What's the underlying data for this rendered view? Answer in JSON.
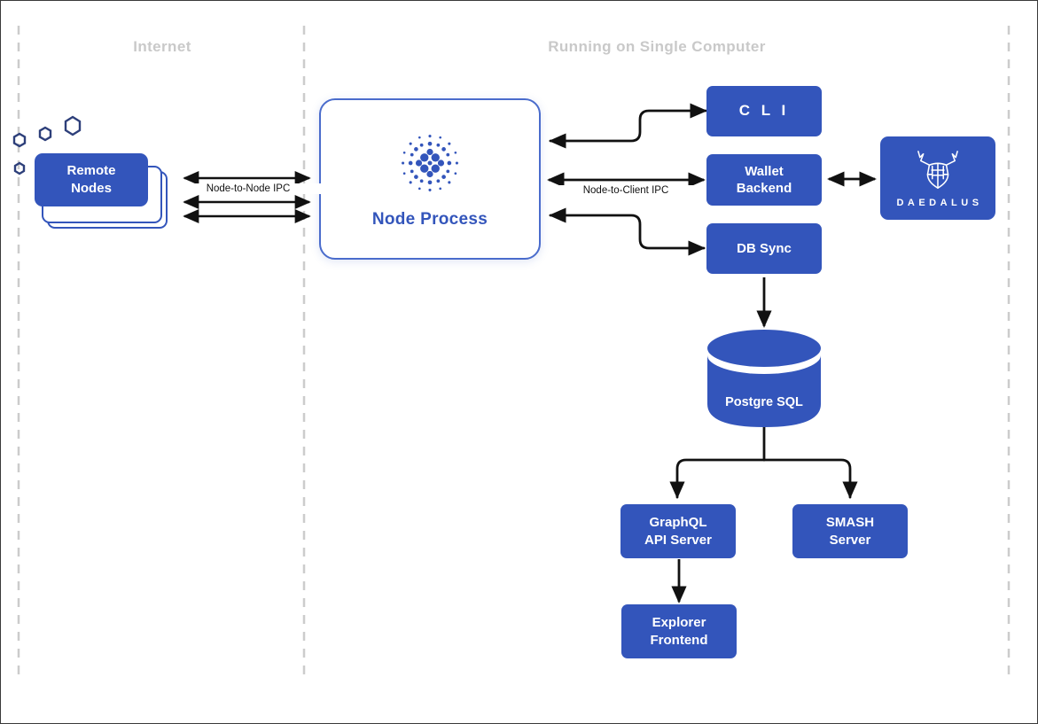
{
  "zones": [
    {
      "name": "internet",
      "label": "Internet"
    },
    {
      "name": "single-computer",
      "label": "Running on Single Computer"
    }
  ],
  "remote_nodes": {
    "label": "Remote Nodes",
    "line1": "Remote",
    "line2": "Nodes"
  },
  "node_process": {
    "label": "Node Process",
    "logo": "cardano-logo"
  },
  "connections": {
    "node_to_node_label": "Node-to-Node IPC",
    "node_to_client_label": "Node-to-Client IPC"
  },
  "services": [
    {
      "name": "cli",
      "label": "C L I",
      "style": "spaced"
    },
    {
      "name": "wallet-backend",
      "line1": "Wallet",
      "line2": "Backend"
    },
    {
      "name": "db-sync",
      "label": "DB Sync"
    }
  ],
  "daedalus": {
    "label": "DAEDALUS",
    "logo": "daedalus-bull-icon"
  },
  "database": {
    "label": "Postgre SQL"
  },
  "downstream": [
    {
      "name": "graphql-api-server",
      "line1": "GraphQL",
      "line2": "API Server"
    },
    {
      "name": "smash-server",
      "line1": "SMASH",
      "line2": "Server"
    },
    {
      "name": "explorer-frontend",
      "line1": "Explorer",
      "line2": "Frontend"
    }
  ],
  "colors": {
    "brand_blue": "#3355bb",
    "process_border": "#4a6ccc",
    "divider_grey": "#cccccc",
    "header_grey": "#c9c9c9",
    "arrow_black": "#111111"
  }
}
